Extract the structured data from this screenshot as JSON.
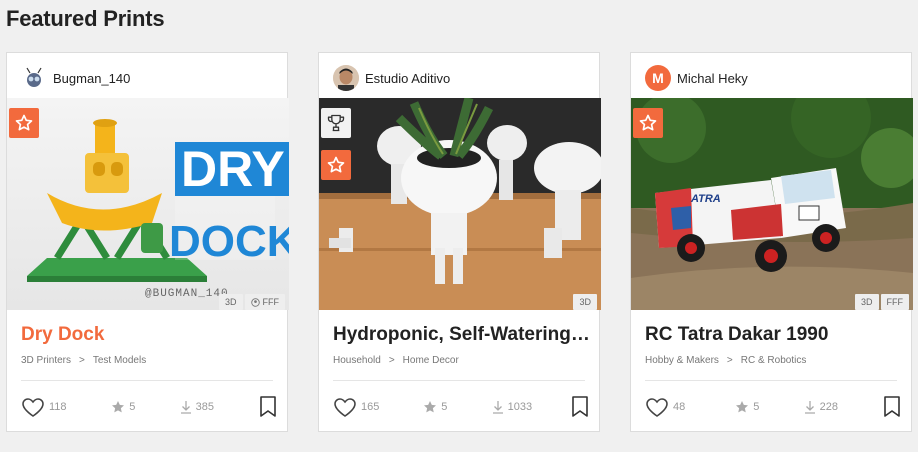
{
  "section_title": "Featured Prints",
  "colors": {
    "accent": "#f26a3d",
    "text": "#222222",
    "muted": "#777777"
  },
  "cards": [
    {
      "author": "Bugman_140",
      "print_name": "Dry Dock",
      "category": "3D Printers",
      "separator": ">",
      "subcategory": "Test Models",
      "tags": [
        "3D",
        "FFF"
      ],
      "likes": "118",
      "rating": "5",
      "downloads": "385",
      "image_text_line1": "DRY",
      "image_text_line2": "DOCK",
      "watermark": "@BUGMAN_140"
    },
    {
      "author": "Estudio Aditivo",
      "print_name": "Hydroponic, Self-Watering Flowerpot Robert Planter",
      "category": "Household",
      "separator": ">",
      "subcategory": "Home Decor",
      "tags": [
        "3D"
      ],
      "likes": "165",
      "rating": "5",
      "downloads": "1033"
    },
    {
      "author": "Michal Heky",
      "author_initial": "M",
      "print_name": "RC Tatra Dakar 1990",
      "category": "Hobby & Makers",
      "separator": ">",
      "subcategory": "RC & Robotics",
      "tags": [
        "3D",
        "FFF"
      ],
      "likes": "48",
      "rating": "5",
      "downloads": "228",
      "truck_text": "ATRA"
    }
  ]
}
